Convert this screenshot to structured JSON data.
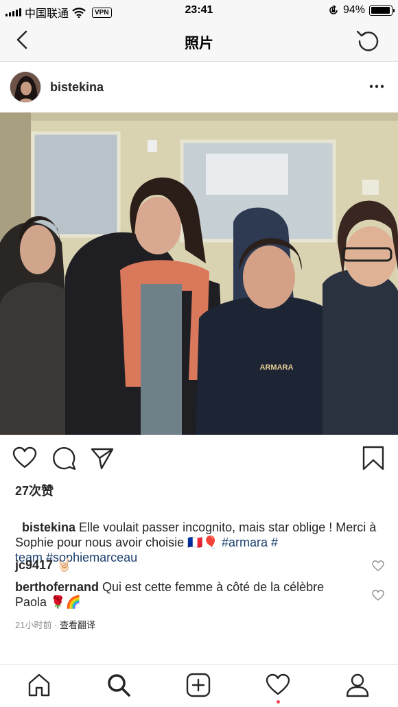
{
  "status_bar": {
    "carrier": "中国联通",
    "vpn": "VPN",
    "time": "23:41",
    "battery": "94%",
    "battery_level": 0.94
  },
  "nav": {
    "title": "照片"
  },
  "post": {
    "username": "bistekina",
    "likes": "27次赞",
    "caption": {
      "author": "bistekina",
      "text_1": " Elle voulait passer incognito, mais star oblige ! Merci à Sophie pour nous avoir choisie ",
      "emoji": "🇫🇷🎈",
      "tag_1": "#armara",
      "text_2": " #\nteam ",
      "tag_2": "#sophiemarceau"
    },
    "photo_text": {
      "brand": "ARMARA"
    },
    "comments": [
      {
        "author": "jc9417",
        "text": " 🤘🏻"
      },
      {
        "author": "berthofernand",
        "text": " Qui est cette femme à côté de la célèbre Paola 🌹🌈"
      }
    ],
    "timestamp": "21小时前",
    "separator": " · ",
    "translate": "查看翻译"
  },
  "icons": {
    "back": "chevron-left-icon",
    "refresh": "refresh-icon",
    "more": "more-horizontal-icon",
    "like": "heart-icon",
    "comment": "comment-icon",
    "share": "send-icon",
    "save": "bookmark-icon",
    "tabs": [
      "home-icon",
      "search-icon",
      "add-post-icon",
      "activity-heart-icon",
      "profile-icon"
    ]
  },
  "colors": {
    "hashtag": "#1b3f6e",
    "notification_dot": "#ed4956",
    "muted": "#8e8e8e"
  }
}
